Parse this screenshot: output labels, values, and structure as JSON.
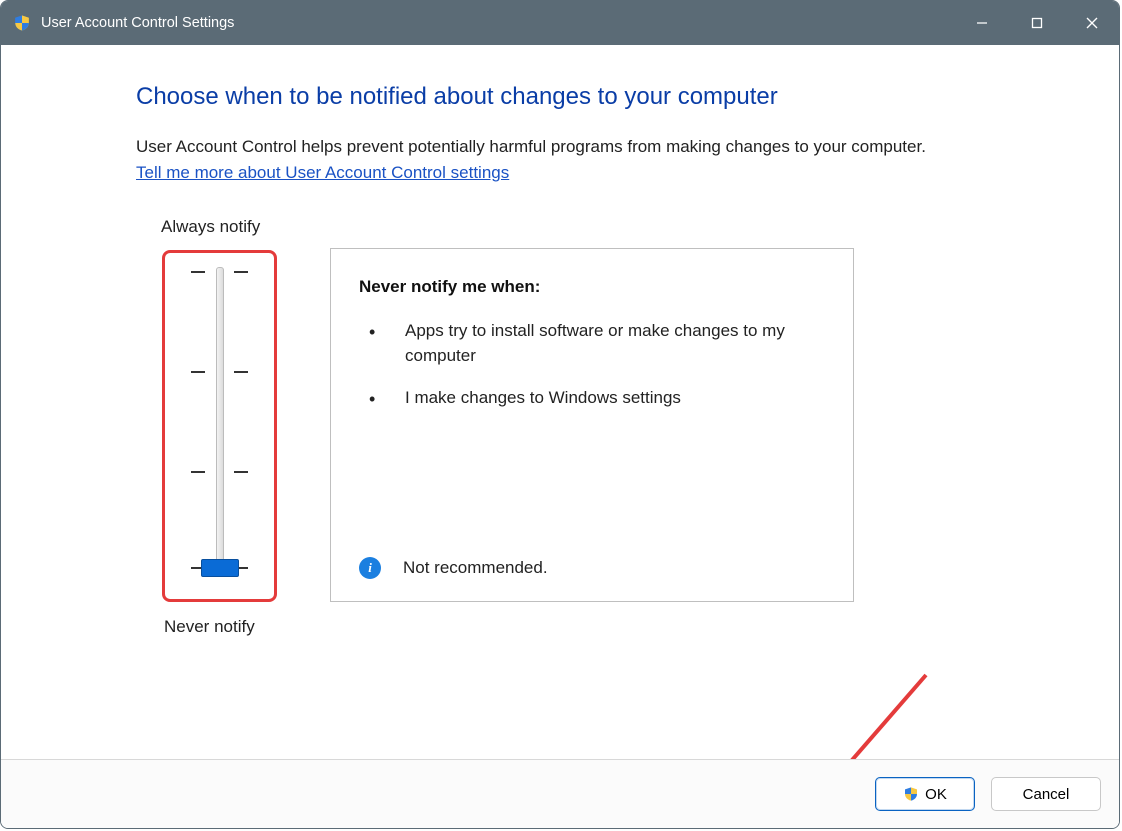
{
  "window": {
    "title": "User Account Control Settings"
  },
  "main": {
    "heading": "Choose when to be notified about changes to your computer",
    "description": "User Account Control helps prevent potentially harmful programs from making changes to your computer.",
    "learn_more": "Tell me more about User Account Control settings"
  },
  "slider": {
    "top_label": "Always notify",
    "bottom_label": "Never notify",
    "levels": 4,
    "selected_level": 0
  },
  "panel": {
    "heading": "Never notify me when:",
    "bullets": [
      "Apps try to install software or make changes to my computer",
      "I make changes to Windows settings"
    ],
    "footer_text": "Not recommended."
  },
  "buttons": {
    "ok": "OK",
    "cancel": "Cancel"
  },
  "icons": {
    "shield": "shield-icon",
    "info": "info-icon"
  },
  "annotation": {
    "arrow_target": "ok-button",
    "highlight_target": "notify-slider"
  }
}
